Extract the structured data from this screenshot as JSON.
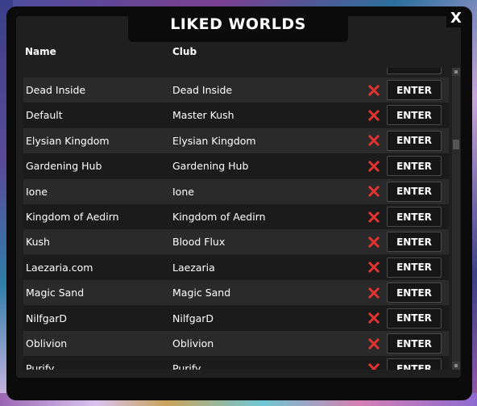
{
  "window": {
    "title": "LIKED WORLDS",
    "close_label": "X"
  },
  "columns": {
    "name": "Name",
    "club": "Club"
  },
  "enter_label": "ENTER",
  "rows": [
    {
      "name": "Dead  Inside",
      "club": "Dead  Inside"
    },
    {
      "name": "Default",
      "club": "Master Kush"
    },
    {
      "name": "Elysian Kingdom",
      "club": "Elysian Kingdom"
    },
    {
      "name": "Gardening Hub",
      "club": "Gardening Hub"
    },
    {
      "name": "Ione",
      "club": "Ione"
    },
    {
      "name": "Kingdom of Aedirn",
      "club": "Kingdom of Aedirn"
    },
    {
      "name": "Kush",
      "club": "Blood Flux"
    },
    {
      "name": "Laezaria.com",
      "club": "Laezaria"
    },
    {
      "name": "Magic Sand",
      "club": "Magic Sand"
    },
    {
      "name": "NilfgarD",
      "club": "NilfgarD"
    },
    {
      "name": "Oblivion",
      "club": "Oblivion"
    },
    {
      "name": "Purify",
      "club": "Purify"
    }
  ],
  "colors": {
    "remove": "#e0322e",
    "panel": "#0b0b0b",
    "row_alt": "#2a2a2a"
  },
  "icons": {
    "remove": "x-icon",
    "close": "close-icon"
  }
}
